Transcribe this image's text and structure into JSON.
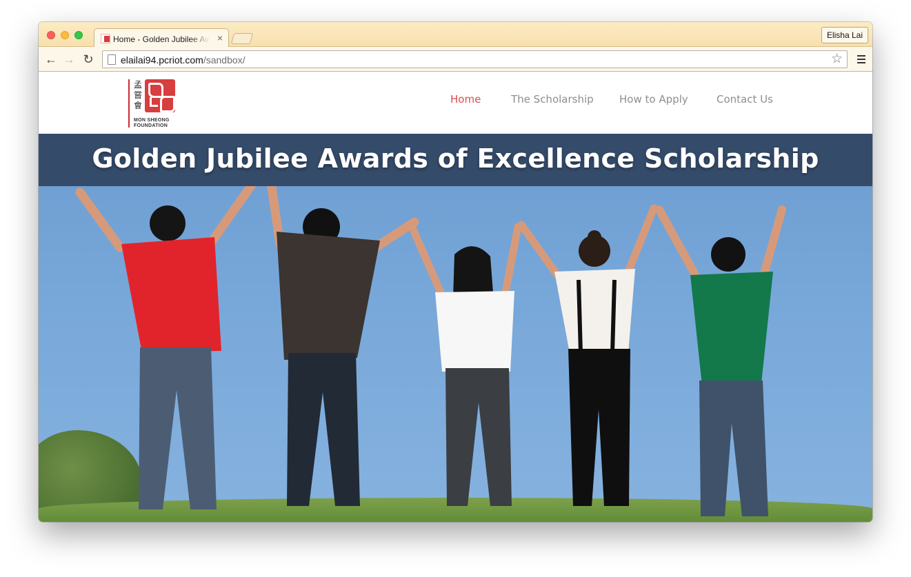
{
  "browser": {
    "tab_title": "Home - Golden Jubilee Awa",
    "tab_close": "×",
    "profile_name": "Elisha Lai",
    "url_host": "elailai94.pcriot.com",
    "url_path": "/sandbox/",
    "back_icon": "←",
    "forward_icon": "→",
    "reload_icon": "↻",
    "star_icon": "☆"
  },
  "site": {
    "logo": {
      "chinese": "孟嘗會",
      "line1": "MON SHEONG",
      "line2": "FOUNDATION"
    },
    "nav": [
      {
        "label": "Home",
        "active": true
      },
      {
        "label": "The Scholarship",
        "active": false
      },
      {
        "label": "How to Apply",
        "active": false
      },
      {
        "label": "Contact Us",
        "active": false
      }
    ],
    "hero_title": "Golden Jubilee Awards of Excellence Scholarship"
  },
  "colors": {
    "accent": "#e24949",
    "nav_text": "#8e8e8e",
    "banner": "#344b6a",
    "sky": "#77a7d9"
  }
}
